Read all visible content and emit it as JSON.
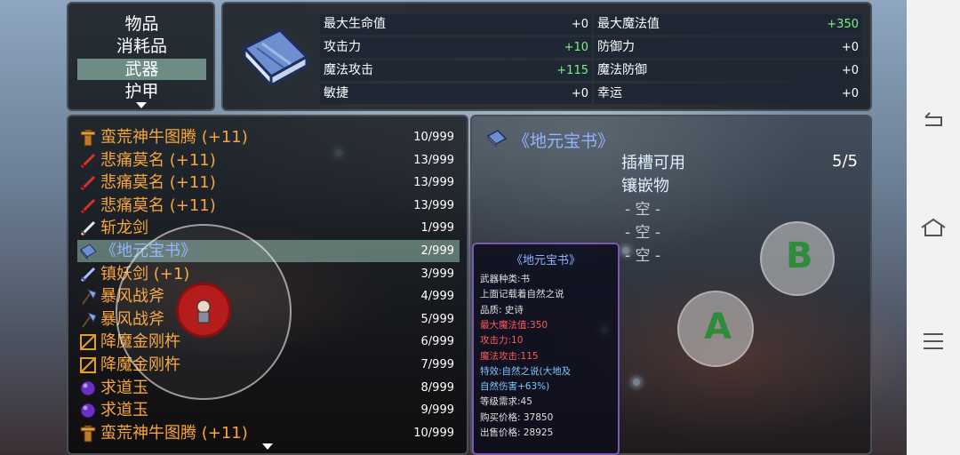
{
  "categories": [
    "物品",
    "消耗品",
    "武器",
    "护甲"
  ],
  "selected_category_index": 2,
  "stats": {
    "left": [
      {
        "label": "最大生命值",
        "value": "+0",
        "positive": false
      },
      {
        "label": "攻击力",
        "value": "+10",
        "positive": true
      },
      {
        "label": "魔法攻击",
        "value": "+115",
        "positive": true
      },
      {
        "label": "敏捷",
        "value": "+0",
        "positive": false
      }
    ],
    "right": [
      {
        "label": "最大魔法值",
        "value": "+350",
        "positive": true
      },
      {
        "label": "防御力",
        "value": "+0",
        "positive": false
      },
      {
        "label": "魔法防御",
        "value": "+0",
        "positive": false
      },
      {
        "label": "幸运",
        "value": "+0",
        "positive": false
      }
    ]
  },
  "items": [
    {
      "name": "蛮荒神牛图腾 (+11)",
      "qty": "10/999",
      "icon": "totem-icon",
      "color": "orange"
    },
    {
      "name": "悲痛莫名 (+11)",
      "qty": "13/999",
      "icon": "red-sword-icon",
      "color": "orange"
    },
    {
      "name": "悲痛莫名 (+11)",
      "qty": "13/999",
      "icon": "red-sword-icon",
      "color": "orange"
    },
    {
      "name": "悲痛莫名 (+11)",
      "qty": "13/999",
      "icon": "red-sword-icon",
      "color": "orange"
    },
    {
      "name": "斩龙剑",
      "qty": "1/999",
      "icon": "sword-icon",
      "color": "orange"
    },
    {
      "name": "《地元宝书》",
      "qty": "2/999",
      "icon": "book-icon",
      "color": "blue"
    },
    {
      "name": "镇妖剑 (+1)",
      "qty": "3/999",
      "icon": "blue-sword-icon",
      "color": "orange"
    },
    {
      "name": "暴风战斧",
      "qty": "4/999",
      "icon": "axe-icon",
      "color": "orange"
    },
    {
      "name": "暴风战斧",
      "qty": "5/999",
      "icon": "axe-icon",
      "color": "orange"
    },
    {
      "name": "降魔金刚杵",
      "qty": "6/999",
      "icon": "vajra-icon",
      "color": "orange"
    },
    {
      "name": "降魔金刚杵",
      "qty": "7/999",
      "icon": "vajra-icon",
      "color": "orange"
    },
    {
      "name": "求道玉",
      "qty": "8/999",
      "icon": "orb-icon",
      "color": "orange"
    },
    {
      "name": "求道玉",
      "qty": "9/999",
      "icon": "orb-icon",
      "color": "orange"
    },
    {
      "name": "蛮荒神牛图腾 (+11)",
      "qty": "10/999",
      "icon": "totem-icon",
      "color": "orange"
    }
  ],
  "selected_item_index": 5,
  "detail": {
    "title": "《地元宝书》",
    "slot_label": "插槽可用",
    "slot_count": "5/5",
    "inlay_label": "镶嵌物",
    "empty_slots": [
      "- 空 -",
      "- 空 -",
      "- 空 -"
    ]
  },
  "tooltip": {
    "title": "《地元宝书》",
    "lines": [
      {
        "text": "武器种类:书",
        "color": "#e0e0e0"
      },
      {
        "text": "上面记载着自然之说",
        "color": "#e0e0e0"
      },
      {
        "text": "品质: 史诗",
        "color": "#e0e0e0"
      },
      {
        "text": "最大魔法值:350",
        "color": "#ff5a5a"
      },
      {
        "text": "攻击力:10",
        "color": "#ff5a5a"
      },
      {
        "text": "魔法攻击:115",
        "color": "#ff5a5a"
      },
      {
        "text": "特效:自然之说(大地及",
        "color": "#7ec8ff"
      },
      {
        "text": "自然伤害+63%)",
        "color": "#7ec8ff"
      },
      {
        "text": "等级需求:45",
        "color": "#e0e0e0"
      },
      {
        "text": "购买价格: 37850",
        "color": "#e0e0e0"
      },
      {
        "text": "出售价格: 28925",
        "color": "#e0e0e0"
      }
    ]
  },
  "controls": {
    "a_label": "A",
    "b_label": "B"
  },
  "colors": {
    "item_orange": "#f6a53b",
    "item_blue": "#8fb4ff",
    "stat_positive": "#7df07d",
    "selection": "#6e8c86"
  }
}
